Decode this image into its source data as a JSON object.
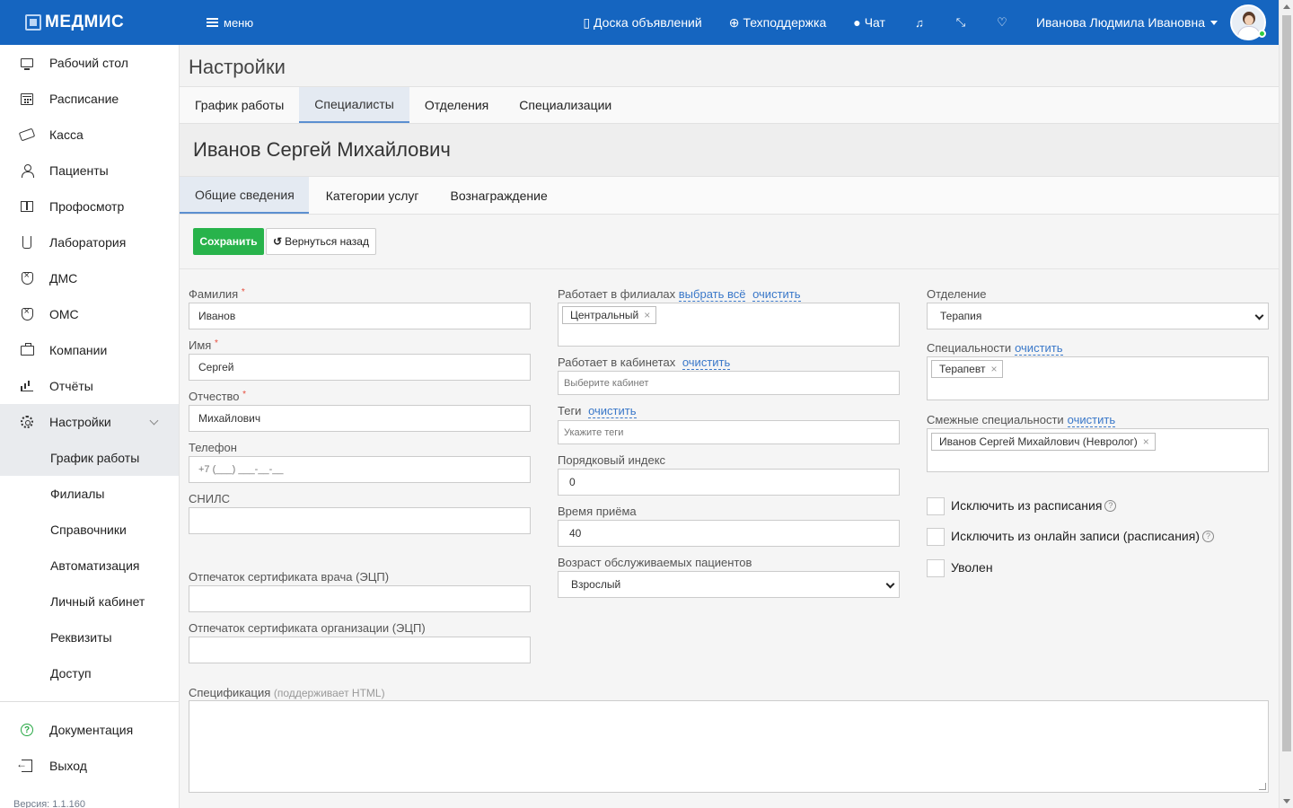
{
  "header": {
    "brand": "МЕДМИС",
    "menu_label": "меню",
    "links": {
      "board": "Доска объявлений",
      "support": "Техподдержка",
      "chat": "Чат"
    },
    "user_name": "Иванова Людмила Ивановна"
  },
  "sidebar": {
    "items": [
      {
        "label": "Рабочий стол",
        "icon": "monitor-icon"
      },
      {
        "label": "Расписание",
        "icon": "calendar-icon"
      },
      {
        "label": "Касса",
        "icon": "cash-icon"
      },
      {
        "label": "Пациенты",
        "icon": "user-icon"
      },
      {
        "label": "Профосмотр",
        "icon": "book-icon"
      },
      {
        "label": "Лаборатория",
        "icon": "flask-icon"
      },
      {
        "label": "ДМС",
        "icon": "shield-icon"
      },
      {
        "label": "ОМС",
        "icon": "shield-icon"
      },
      {
        "label": "Компании",
        "icon": "briefcase-icon"
      },
      {
        "label": "Отчёты",
        "icon": "bar-chart-icon"
      },
      {
        "label": "Настройки",
        "icon": "gear-icon"
      }
    ],
    "sub_items": [
      "График работы",
      "Филиалы",
      "Справочники",
      "Автоматизация",
      "Личный кабинет",
      "Реквизиты",
      "Доступ"
    ],
    "bottom": [
      "Документация",
      "Выход"
    ],
    "version": "Версия: 1.1.160"
  },
  "page": {
    "title": "Настройки",
    "tabs": [
      "График работы",
      "Специалисты",
      "Отделения",
      "Специализации"
    ],
    "person_name": "Иванов Сергей Михайлович",
    "subtabs": [
      "Общие сведения",
      "Категории услуг",
      "Вознаграждение"
    ],
    "save_label": "Сохранить",
    "back_label": "Вернуться назад"
  },
  "form": {
    "surname": {
      "label": "Фамилия",
      "value": "Иванов"
    },
    "name": {
      "label": "Имя",
      "value": "Сергей"
    },
    "patronymic": {
      "label": "Отчество",
      "value": "Михайлович"
    },
    "phone": {
      "label": "Телефон",
      "placeholder": "+7 (___) ___-__-__"
    },
    "snils": {
      "label": "СНИЛС",
      "value": ""
    },
    "doctor_cert": {
      "label": "Отпечаток сертификата врача (ЭЦП)",
      "value": ""
    },
    "org_cert": {
      "label": "Отпечаток сертификата организации (ЭЦП)",
      "value": ""
    },
    "branches": {
      "label": "Работает в филиалах",
      "select_all": "выбрать всё",
      "clear": "очистить",
      "chips": [
        "Центральный"
      ]
    },
    "rooms": {
      "label": "Работает в кабинетах",
      "clear": "очистить",
      "placeholder": "Выберите кабинет"
    },
    "tags": {
      "label": "Теги",
      "clear": "очистить",
      "placeholder": "Укажите теги"
    },
    "order_index": {
      "label": "Порядковый индекс",
      "value": "0"
    },
    "appointment_time": {
      "label": "Время приёма",
      "value": "40"
    },
    "patient_age": {
      "label": "Возраст обслуживаемых пациентов",
      "value": "Взрослый"
    },
    "department": {
      "label": "Отделение",
      "value": "Терапия"
    },
    "specialties": {
      "label": "Специальности",
      "clear": "очистить",
      "chips": [
        "Терапевт"
      ]
    },
    "related_specialties": {
      "label": "Смежные специальности",
      "clear": "очистить",
      "chips": [
        "Иванов Сергей Михайлович (Невролог)"
      ]
    },
    "checkboxes": [
      "Исключить из расписания",
      "Исключить из онлайн записи (расписания)",
      "Уволен"
    ],
    "specification": {
      "label": "Спецификация",
      "hint": "(поддерживает HTML)"
    }
  },
  "colors": {
    "topbar": "#1565c0",
    "save": "#28b34b",
    "link": "#3a78c9"
  }
}
